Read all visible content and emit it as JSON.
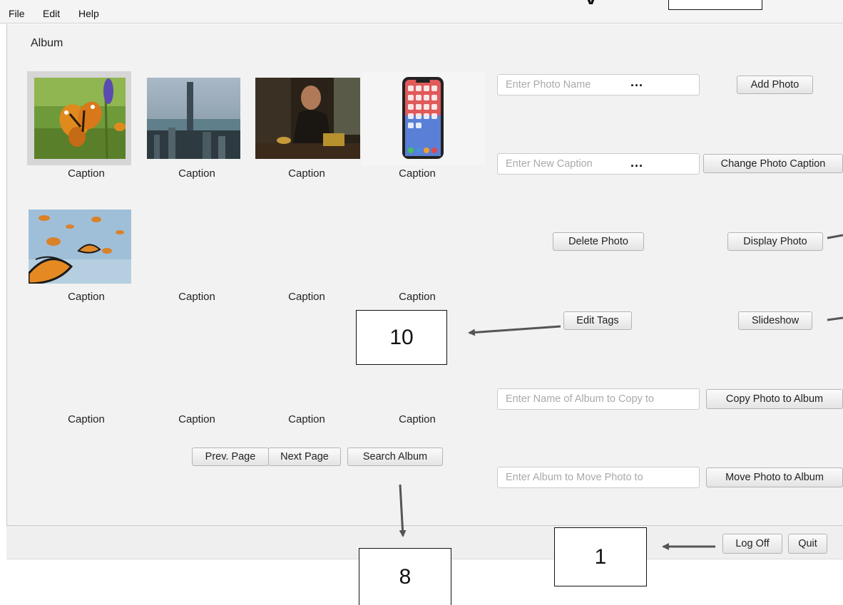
{
  "menu": {
    "items": [
      "File",
      "Edit",
      "Help"
    ]
  },
  "album": {
    "title": "Album"
  },
  "grid": {
    "rows": [
      [
        "Caption",
        "Caption",
        "Caption",
        "Caption"
      ],
      [
        "Caption",
        "Caption",
        "Caption",
        "Caption"
      ],
      [
        "Caption",
        "Caption",
        "Caption",
        "Caption"
      ]
    ]
  },
  "pagination": {
    "prev_label": "Prev. Page",
    "next_label": "Next Page",
    "search_label": "Search Album"
  },
  "actions": {
    "photo_name_placeholder": "Enter Photo Name",
    "add_photo_label": "Add Photo",
    "caption_placeholder": "Enter New Caption",
    "change_caption_label": "Change Photo Caption",
    "delete_label": "Delete Photo",
    "display_label": "Display Photo",
    "edit_tags_label": "Edit Tags",
    "slideshow_label": "Slideshow",
    "copy_placeholder": "Enter Name of Album to Copy to",
    "copy_label": "Copy Photo to Album",
    "move_placeholder": "Enter Album to Move Photo to",
    "move_label": "Move Photo to Album",
    "ellipsis": "..."
  },
  "footer": {
    "logoff_label": "Log Off",
    "quit_label": "Quit"
  },
  "annotations": {
    "box_10": "10",
    "box_8": "8",
    "box_1": "1"
  }
}
